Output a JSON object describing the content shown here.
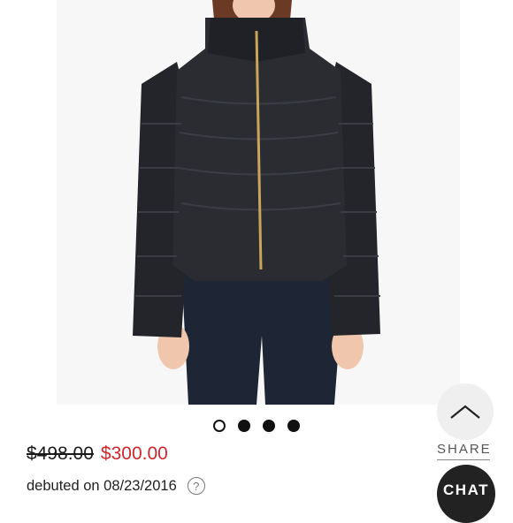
{
  "product": {
    "original_price": "$498.00",
    "sale_price": "$300.00",
    "debuted_text": "debuted on 08/23/2016",
    "help_icon_glyph": "?"
  },
  "carousel": {
    "total_images": 4,
    "active_index": 0
  },
  "actions": {
    "share_label": "SHARE",
    "chat_label": "CHAT"
  },
  "colors": {
    "sale_price": "#d0262b",
    "chat_bg": "#222222"
  },
  "icons": [
    "chevron-up-icon",
    "help-icon"
  ]
}
